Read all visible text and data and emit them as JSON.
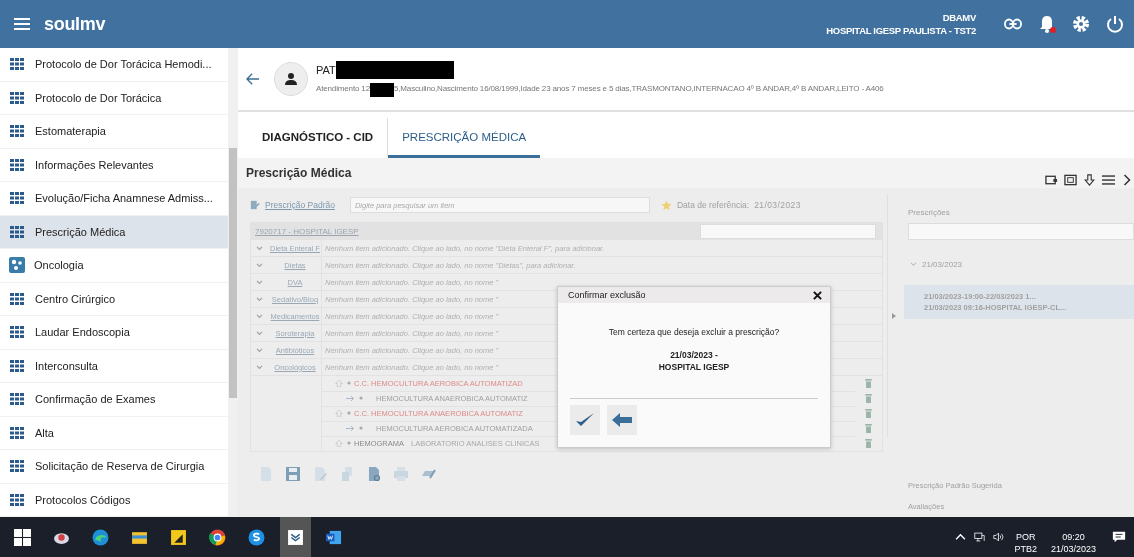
{
  "header": {
    "logo": "soulmv",
    "user": "DBAMV",
    "unit": "HOSPITAL IGESP PAULISTA - TST2",
    "notification": true
  },
  "sidebar": {
    "items": [
      {
        "label": "Protocolo de Dor Torácica Hemodi...",
        "selected": false,
        "kind": "grid"
      },
      {
        "label": "Protocolo de Dor Torácica",
        "selected": false,
        "kind": "grid"
      },
      {
        "label": "Estomaterapia",
        "selected": false,
        "kind": "grid"
      },
      {
        "label": "Informações Relevantes",
        "selected": false,
        "kind": "grid"
      },
      {
        "label": "Evolução/Ficha Anamnese Admiss...",
        "selected": false,
        "kind": "grid"
      },
      {
        "label": "Prescrição Médica",
        "selected": true,
        "kind": "grid"
      },
      {
        "label": "Oncologia",
        "selected": false,
        "kind": "oncology"
      },
      {
        "label": "Centro Cirúrgico",
        "selected": false,
        "kind": "grid"
      },
      {
        "label": "Laudar Endoscopia",
        "selected": false,
        "kind": "grid"
      },
      {
        "label": "Interconsulta",
        "selected": false,
        "kind": "grid"
      },
      {
        "label": "Confirmação de Exames",
        "selected": false,
        "kind": "grid"
      },
      {
        "label": "Alta",
        "selected": false,
        "kind": "grid"
      },
      {
        "label": "Solicitação de Reserva de Cirurgia",
        "selected": false,
        "kind": "grid"
      },
      {
        "label": "Protocolos Códigos",
        "selected": false,
        "kind": "grid"
      }
    ]
  },
  "patient": {
    "name": "PAT",
    "details_start": "Atendimento 12",
    "details_end": "5,Masculino,Nascimento 16/08/1999,Idade 23 anos 7 meses e 5 dias,TRASMONTANO,INTERNACAO 4º B ANDAR,4º B ANDAR,LEITO - A406"
  },
  "tabs": [
    {
      "label": "DIAGNÓSTICO - CID",
      "selected": false
    },
    {
      "label": "PRESCRIÇÃO MÉDICA",
      "selected": true
    }
  ],
  "panel": {
    "title": "Prescrição Médica"
  },
  "prescription": {
    "standard_link": "Prescrição Padrão",
    "search_placeholder": "Digite para pesquisar um item",
    "reference_label": "Data de referência:",
    "reference_date": "21/03/2023",
    "group": "7920717 - HOSPITAL IGESP",
    "categories": [
      {
        "name": "Dieta Enteral F",
        "message": "Nenhum item adicionado. Clique ao lado, no nome \"Dieta Enteral F\", para adicionar."
      },
      {
        "name": "Dietas",
        "message": "Nenhum item adicionado. Clique ao lado, no nome \"Dietas\", para adicionar."
      },
      {
        "name": "DVA",
        "message": "Nenhum item adicionado. Clique ao lado, no nome \""
      },
      {
        "name": "Sedativo/Bloq",
        "message": "Nenhum item adicionado. Clique ao lado, no nome \""
      },
      {
        "name": "Medicamentos",
        "message": "Nenhum item adicionado. Clique ao lado, no nome \""
      },
      {
        "name": "Soroterapia",
        "message": "Nenhum item adicionado. Clique ao lado, no nome \""
      },
      {
        "name": "Antibióticos",
        "message": "Nenhum item adicionado. Clique ao lado, no nome \""
      },
      {
        "name": "Oncológicos",
        "message": "Nenhum item adicionado. Clique ao lado, no nome \""
      }
    ],
    "items": [
      {
        "kind": "main",
        "name": "C.C. HEMOCULTURA AEROBICA AUTOMATIZAD"
      },
      {
        "kind": "sub",
        "name": "HEMOCULTURA ANAEROBICA AUTOMATIZ"
      },
      {
        "kind": "main",
        "name": "C.C. HEMOCULTURA ANAEROBICA AUTOMATIZ"
      },
      {
        "kind": "sub",
        "name": "HEMOCULTURA AEROBICA AUTOMATIZADA"
      },
      {
        "kind": "plain",
        "name": "HEMOGRAMA",
        "lab": "LABORATORIO ANALISES CLINICAS"
      }
    ]
  },
  "prescriptions": {
    "title": "Prescrições",
    "date": "21/03/2023",
    "entries": [
      {
        "line1": "21/03/2023-19:00-22/03/2023 1...",
        "line2": "21/03/2023 09:16-HOSPITAL IGESP-CL...",
        "selected": true
      }
    ],
    "footer": [
      "Prescrição Padrão Sugerida",
      "Avaliações"
    ]
  },
  "dialog": {
    "title": "Confirmar exclusão",
    "message": "Tem certeza que deseja excluir a prescrição?",
    "detail": [
      "21/03/2023 -",
      "HOSPITAL IGESP"
    ]
  },
  "taskbar": {
    "language": "POR",
    "layout": "PTB2",
    "time": "09:20",
    "date": "21/03/2023"
  }
}
